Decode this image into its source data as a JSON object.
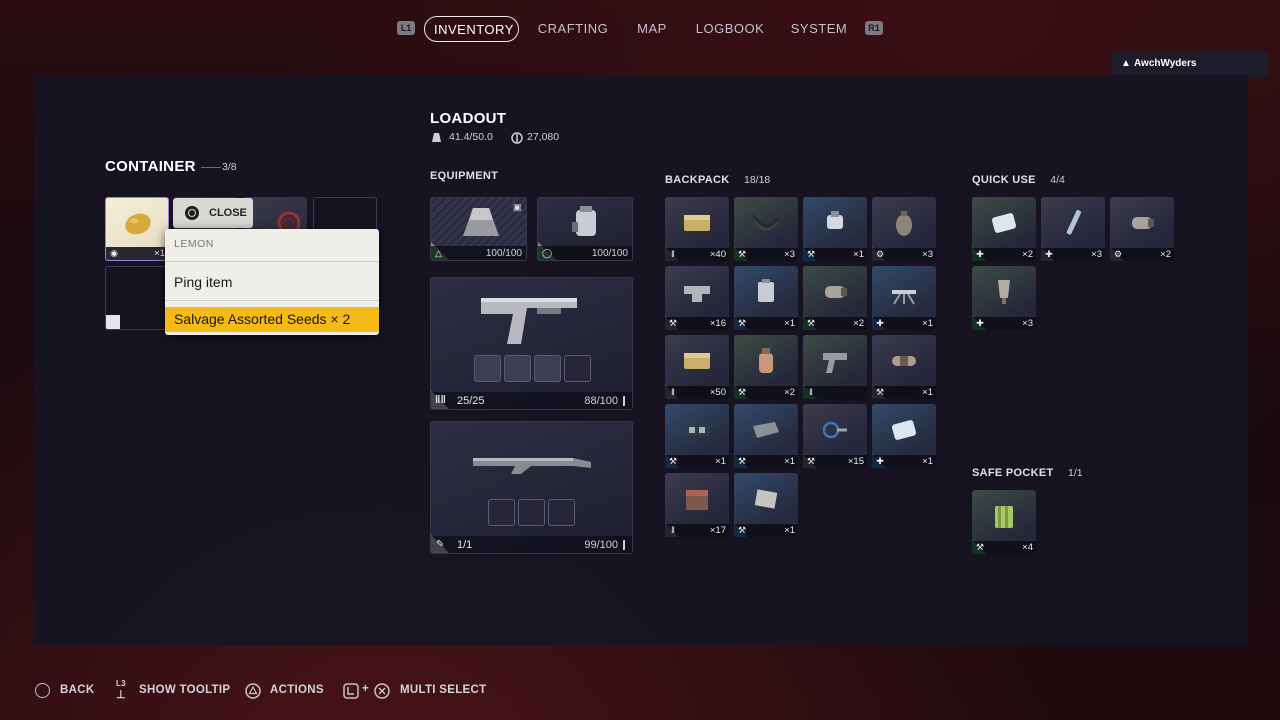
{
  "nav": {
    "left_button": "L1",
    "right_button": "R1",
    "tabs": [
      {
        "label": "INVENTORY",
        "active": true
      },
      {
        "label": "CRAFTING",
        "active": false
      },
      {
        "label": "MAP",
        "active": false
      },
      {
        "label": "LOGBOOK",
        "active": false
      },
      {
        "label": "SYSTEM",
        "active": false
      }
    ]
  },
  "user": {
    "name": "AwchWyders",
    "icon": "speaker-icon"
  },
  "container": {
    "title": "CONTAINER",
    "count": "3/8",
    "selected_item_qty": "×1",
    "close_label": "CLOSE"
  },
  "context_menu": {
    "title": "LEMON",
    "ping_label": "Ping item",
    "salvage_label": "Salvage Assorted Seeds × 2"
  },
  "loadout": {
    "title": "LOADOUT",
    "weight": "41.4/50.0",
    "currency": "27,080"
  },
  "equipment": {
    "title": "EQUIPMENT",
    "augment_durability": "100/100",
    "shield_durability": "100/100",
    "weapon1": {
      "ammo": "25/25",
      "durability": "88/100"
    },
    "weapon2": {
      "ammo": "1/1",
      "durability": "99/100"
    }
  },
  "backpack": {
    "title": "BACKPACK",
    "count": "18/18",
    "items": [
      {
        "qty": "×40",
        "type": "ammo-icon",
        "rarity": "neutral",
        "art": "ammo-box"
      },
      {
        "qty": "×3",
        "type": "wrench-icon",
        "rarity": "green",
        "art": "wires"
      },
      {
        "qty": "×1",
        "type": "wrench-icon",
        "rarity": "blue",
        "art": "sensor"
      },
      {
        "qty": "×3",
        "type": "gear-icon",
        "rarity": "neutral",
        "art": "grenade"
      },
      {
        "qty": "×16",
        "type": "wrench-icon",
        "rarity": "neutral",
        "art": "bracket"
      },
      {
        "qty": "×1",
        "type": "wrench-icon",
        "rarity": "blue",
        "art": "battery"
      },
      {
        "qty": "×2",
        "type": "wrench-icon",
        "rarity": "green",
        "art": "canister"
      },
      {
        "qty": "×1",
        "type": "medkit-icon",
        "rarity": "blue",
        "art": "turret"
      },
      {
        "qty": "×50",
        "type": "ammo-icon",
        "rarity": "neutral",
        "art": "ammo-box"
      },
      {
        "qty": "×2",
        "type": "wrench-icon",
        "rarity": "green",
        "art": "bottle"
      },
      {
        "qty": "",
        "type": "ammo-icon",
        "rarity": "green",
        "art": "pistol"
      },
      {
        "qty": "×1",
        "type": "wrench-icon",
        "rarity": "neutral",
        "art": "capsule"
      },
      {
        "qty": "×1",
        "type": "wrench-icon",
        "rarity": "blue",
        "art": "circuit"
      },
      {
        "qty": "×1",
        "type": "wrench-icon",
        "rarity": "blue",
        "art": "plate"
      },
      {
        "qty": "×15",
        "type": "wrench-icon",
        "rarity": "neutral",
        "art": "cables"
      },
      {
        "qty": "×1",
        "type": "medkit-icon",
        "rarity": "blue",
        "art": "bandage"
      },
      {
        "qty": "×17",
        "type": "ammo-icon",
        "rarity": "neutral",
        "art": "crate"
      },
      {
        "qty": "×1",
        "type": "wrench-icon",
        "rarity": "blue",
        "art": "cloth"
      }
    ]
  },
  "quick_use": {
    "title": "QUICK USE",
    "count": "4/4",
    "items": [
      {
        "qty": "×2",
        "type": "medkit-icon",
        "rarity": "green",
        "art": "bandage"
      },
      {
        "qty": "×3",
        "type": "medkit-icon",
        "rarity": "neutral",
        "art": "syringe"
      },
      {
        "qty": "×2",
        "type": "gear-icon",
        "rarity": "neutral",
        "art": "canister"
      },
      {
        "qty": "×3",
        "type": "medkit-icon",
        "rarity": "green",
        "art": "injector"
      }
    ]
  },
  "safe_pocket": {
    "title": "SAFE POCKET",
    "count": "1/1",
    "items": [
      {
        "qty": "×4",
        "type": "wrench-icon",
        "rarity": "green",
        "art": "battery-pack"
      }
    ]
  },
  "footer": {
    "back": "BACK",
    "tooltip_key": "L3",
    "tooltip": "SHOW TOOLTIP",
    "actions": "ACTIONS",
    "multi_plus": "+",
    "multi_select": "MULTI SELECT"
  }
}
